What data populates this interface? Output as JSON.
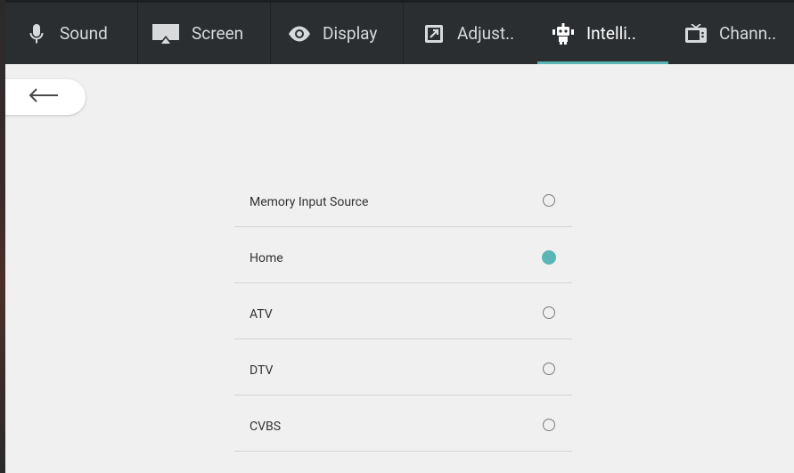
{
  "tabs": [
    {
      "label": "Sound",
      "icon": "microphone-icon",
      "active": false
    },
    {
      "label": "Screen",
      "icon": "screen-icon",
      "active": false
    },
    {
      "label": "Display",
      "icon": "eye-icon",
      "active": false
    },
    {
      "label": "Adjust..",
      "icon": "adjust-icon",
      "active": false
    },
    {
      "label": "Intelli..",
      "icon": "robot-icon",
      "active": true
    },
    {
      "label": "Chann..",
      "icon": "tv-icon",
      "active": false
    }
  ],
  "back_button": {
    "icon": "back-arrow-icon"
  },
  "options": [
    {
      "label": "Memory Input Source",
      "selected": false
    },
    {
      "label": "Home",
      "selected": true
    },
    {
      "label": "ATV",
      "selected": false
    },
    {
      "label": "DTV",
      "selected": false
    },
    {
      "label": "CVBS",
      "selected": false
    }
  ],
  "colors": {
    "accent": "#5ab5b5",
    "tabbar": "#2b2e30",
    "background": "#f0f0f0"
  }
}
